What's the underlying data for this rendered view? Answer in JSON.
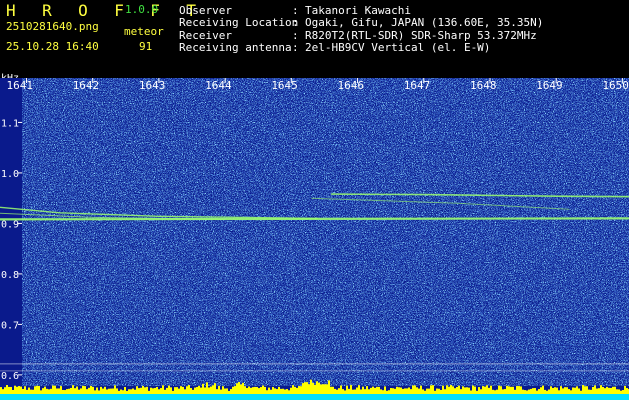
{
  "app": {
    "title": "H R O F F T",
    "version": "1.0.0"
  },
  "capture": {
    "filename": "2510281640.png",
    "datetime": "25.10.28 16:40",
    "meteor_label": "meteor",
    "meteor_count": "91"
  },
  "info": [
    {
      "label": "Observer",
      "value": "Takanori Kawachi"
    },
    {
      "label": "Receiving Location",
      "value": "Ogaki, Gifu, JAPAN (136.60E, 35.35N)"
    },
    {
      "label": "Receiver",
      "value": "R820T2(RTL-SDR) SDR-Sharp 53.372MHz"
    },
    {
      "label": "Receiving antenna",
      "value": "2el-HB9CV Vertical (el. E-W)"
    }
  ],
  "spectrogram": {
    "y_unit": "kHz",
    "time_ticks": [
      "1641",
      "1642",
      "1643",
      "1644",
      "1645",
      "1646",
      "1647",
      "1648",
      "1649",
      "1650"
    ],
    "freq_ticks": [
      "1.1",
      "1.0",
      "0.9",
      "0.8",
      "0.7",
      "0.6"
    ],
    "freq_tick_values": [
      1.1,
      1.0,
      0.9,
      0.8,
      0.7,
      0.6
    ],
    "freq_range": [
      0.578,
      1.188
    ],
    "time_range_minutes": [
      1640.6,
      1650.1
    ],
    "colors": {
      "background": "#0a1a8c",
      "noise_bright": "#5ad2ff",
      "signal": "#9cff70",
      "level_bar": "#ffff00",
      "level_base": "#00e0ff",
      "grid": "#ffffff"
    }
  }
}
